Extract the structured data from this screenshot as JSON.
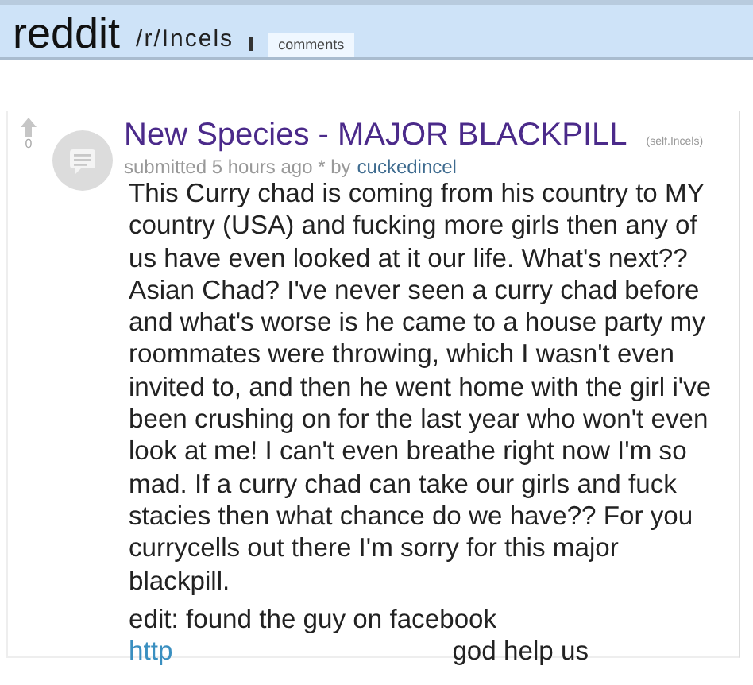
{
  "header": {
    "logo": "reddit",
    "subreddit": "/r/Incels",
    "tabs": [
      {
        "label": "comments",
        "selected": true
      }
    ]
  },
  "post": {
    "score": "0",
    "title": "New Species - MAJOR BLACKPILL",
    "domain": "(self.Incels)",
    "meta_prefix": "submitted 5 hours ago * by",
    "author": "cuckedincel",
    "body": "This Curry chad is coming from his country to MY country (USA) and fucking more girls then any of us have even looked at it our life. What's next?? Asian Chad? I've never seen a curry chad before and what's worse is he came to a house party my roommates were throwing, which I wasn't even invited to, and then he went home with the girl i've been crushing on for the last year who won't even look at me! I can't even breathe right now I'm so mad. If a curry chad can take our girls and fuck stacies then what chance do we have?? For you currycells out there I'm sorry for this major blackpill.",
    "edit": "edit: found the guy on facebook",
    "link": "http",
    "after_link": "god help us"
  }
}
